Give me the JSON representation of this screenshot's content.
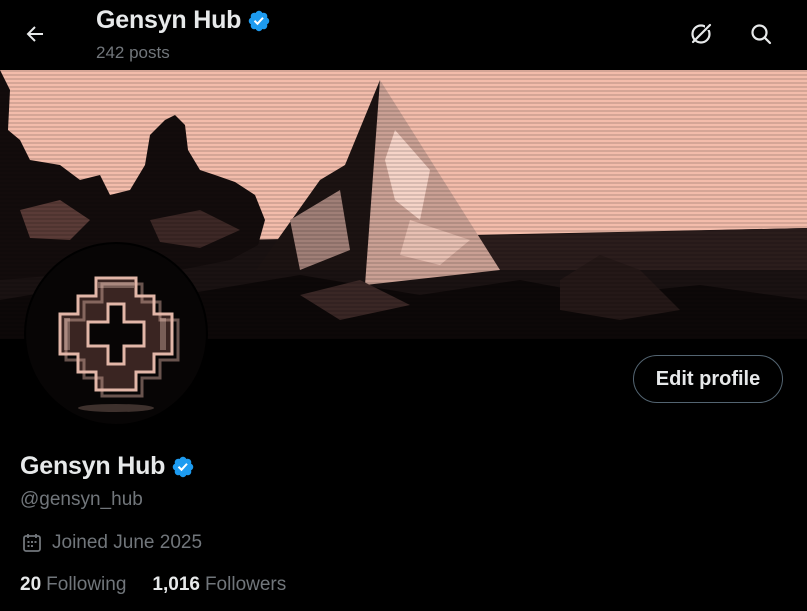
{
  "colors": {
    "background": "#000000",
    "text_primary": "#e7e9ea",
    "text_secondary": "#71767b",
    "verified_blue": "#1d9bf0",
    "button_border": "#536471",
    "banner_tint": "#f0b9a8"
  },
  "header": {
    "back_icon": "arrow-left-icon",
    "title": "Gensyn Hub",
    "posts_count": "242 posts",
    "actions": [
      {
        "icon": "grok-icon"
      },
      {
        "icon": "search-icon"
      }
    ]
  },
  "banner": {
    "description_icon": "pyramid-landscape-banner"
  },
  "avatar": {
    "icon": "gensyn-logo-avatar"
  },
  "profile": {
    "display_name": "Gensyn Hub",
    "verified": true,
    "handle": "@gensyn_hub",
    "joined": "Joined June 2025",
    "edit_button_label": "Edit profile",
    "stats": [
      {
        "value": "20",
        "label": "Following"
      },
      {
        "value": "1,016",
        "label": "Followers"
      }
    ]
  }
}
